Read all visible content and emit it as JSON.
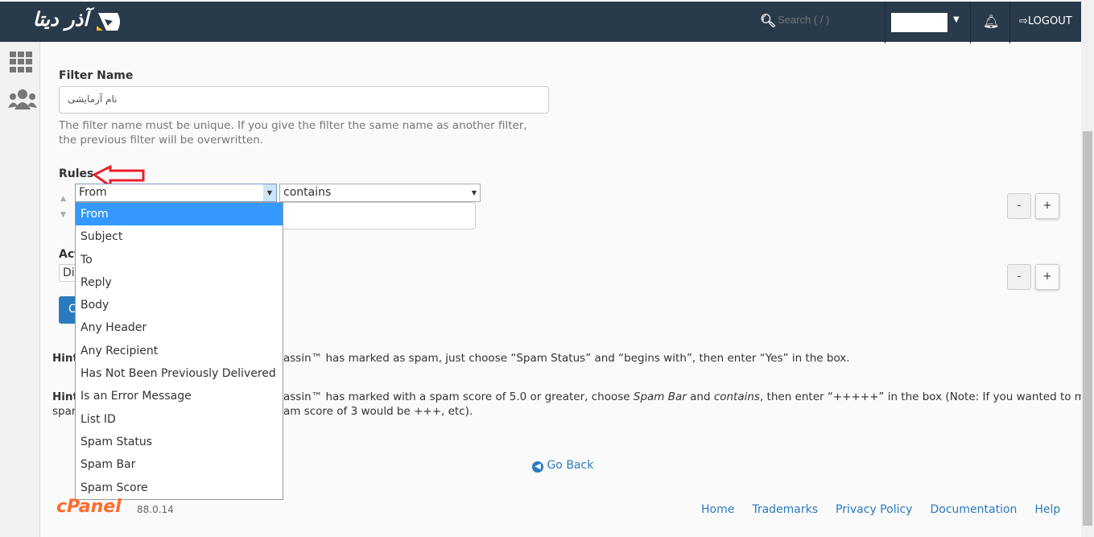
{
  "header": {
    "logo_text": "آذر دیتا",
    "search_placeholder": "Search ( / )",
    "logout": "LOGOUT"
  },
  "form": {
    "filter_name_label": "Filter Name",
    "filter_name_value": "نام آزمایشی",
    "filter_name_help": "The filter name must be unique. If you give the filter the same name as another filter, the previous filter will be overwritten.",
    "rules_label": "Rules",
    "rule_field": "From",
    "rule_operator": "contains",
    "actions_label_fragment": "Act",
    "action_select_fragment": "Di",
    "create_button_fragment": "C",
    "minus": "-",
    "plus": "+"
  },
  "dropdown": {
    "options": [
      "From",
      "Subject",
      "To",
      "Reply",
      "Body",
      "Any Header",
      "Any Recipient",
      "Has Not Been Previously Delivered",
      "Is an Error Message",
      "List ID",
      "Spam Status",
      "Spam Bar",
      "Spam Score"
    ],
    "selected": "From"
  },
  "hints": {
    "h1_label": "Hint",
    "h1_text": "assin™ has marked as spam, just choose “Spam Status” and “begins with”, then enter “Yes” in the box.",
    "h2_label": "Hint",
    "h2_line1": "assin™ has marked with a spam score of 5.0 or greater, choose ",
    "h2_em1": "Spam Bar",
    "h2_mid": " and ",
    "h2_em2": "contains",
    "h2_end": ", then enter “+++++” in the box (Note: If you wanted to match a",
    "h2_line2_left": "spar",
    "h2_line2_right": "am score of 3 would be +++, etc)."
  },
  "go_back": "Go Back",
  "footer": {
    "brand": "cPanel",
    "version": "88.0.14",
    "links": [
      "Home",
      "Trademarks",
      "Privacy Policy",
      "Documentation",
      "Help"
    ]
  },
  "colors": {
    "header": "#293a4a",
    "accent": "#2a7abf",
    "selected_option": "#3399ff",
    "cpanel": "#ff6c2c",
    "annotation_arrow": "#e8202a"
  }
}
